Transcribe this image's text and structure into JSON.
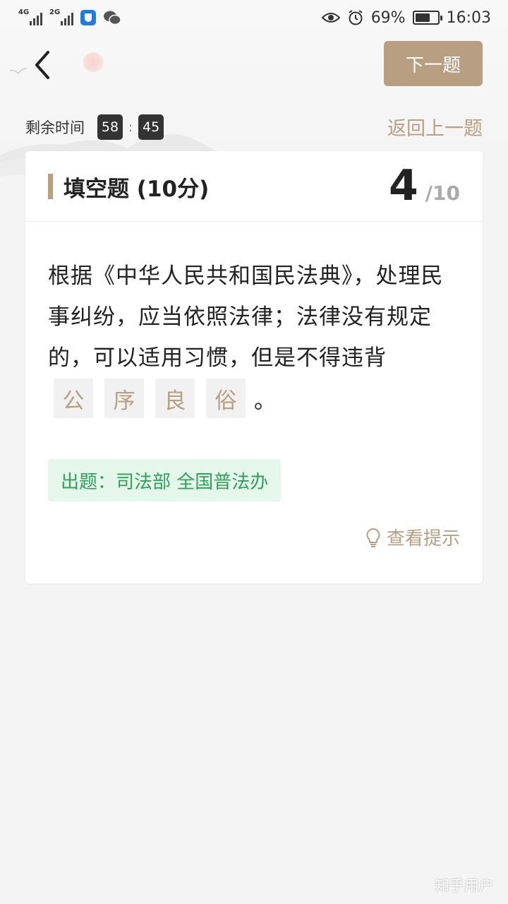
{
  "status_bar": {
    "network1": "4G",
    "network2": "2G",
    "battery": "69%",
    "battery_level": 0.69,
    "time": "16:03",
    "icons": [
      "signal-icon",
      "signal-icon",
      "security-app-icon",
      "wechat-icon",
      "eye-icon",
      "alarm-icon",
      "battery-icon"
    ]
  },
  "header": {
    "back_icon": "chevron-left-icon",
    "next_label": "下一题"
  },
  "timer": {
    "label": "剩余时间",
    "minutes": "58",
    "separator": ":",
    "seconds": "45"
  },
  "prev_label": "返回上一题",
  "question": {
    "type_label": "填空题 (10分)",
    "current": "4",
    "total": "/10",
    "text": "根据《中华人民共和国民法典》，处理民事纠纷，应当依照法律；法律没有规定的，可以适用习惯，但是不得违背",
    "blanks": [
      "公",
      "序",
      "良",
      "俗"
    ],
    "end_punct": "。",
    "source": "出题：司法部 全国普法办",
    "hint_label": "查看提示",
    "hint_icon": "lightbulb-icon"
  },
  "watermark": "知乎用户",
  "colors": {
    "accent": "#b89f82",
    "source_bg": "#e5f6ea",
    "source_text": "#2ea15a"
  }
}
